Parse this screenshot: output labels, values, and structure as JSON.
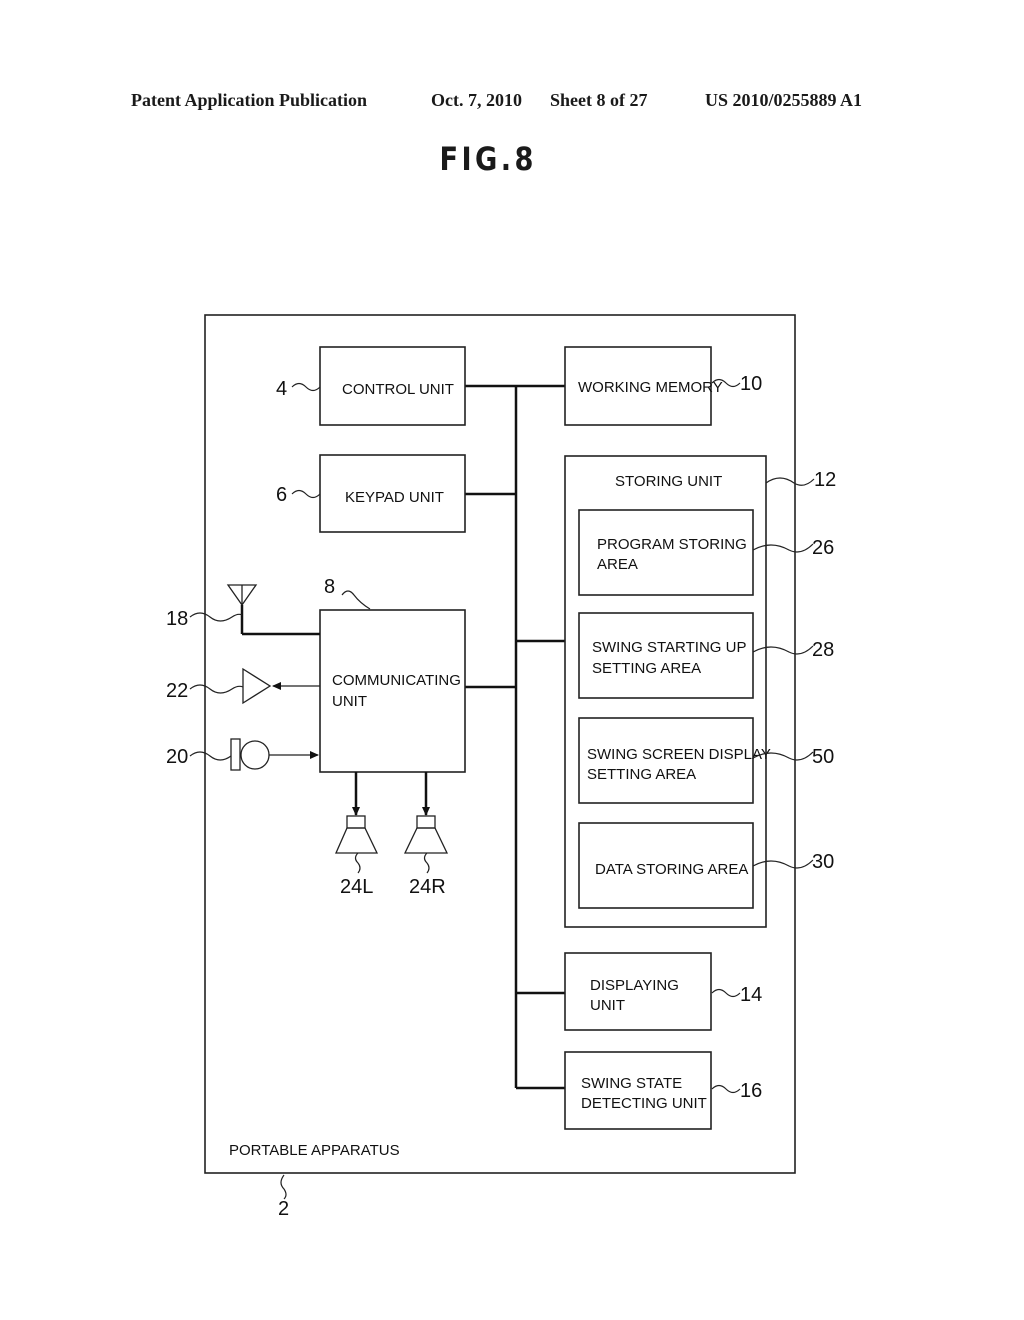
{
  "header": {
    "publication": "Patent Application Publication",
    "date": "Oct. 7, 2010",
    "sheet": "Sheet 8 of 27",
    "number": "US 2010/0255889 A1"
  },
  "figure": {
    "title": "FIG.8"
  },
  "diagram": {
    "outer": {
      "label": "PORTABLE APPARATUS",
      "ref": "2"
    },
    "control_unit": {
      "line1": "CONTROL UNIT",
      "ref": "4"
    },
    "keypad_unit": {
      "line1": "KEYPAD UNIT",
      "ref": "6"
    },
    "communicating_unit": {
      "line1": "COMMUNICATING",
      "line2": "UNIT",
      "ref": "8"
    },
    "working_memory": {
      "line1": "WORKING MEMORY",
      "ref": "10"
    },
    "storing_unit": {
      "line1": "STORING UNIT",
      "ref": "12"
    },
    "program_storing_area": {
      "line1": "PROGRAM STORING",
      "line2": "AREA",
      "ref": "26"
    },
    "swing_starting_up_area": {
      "line1": "SWING STARTING UP",
      "line2": "SETTING AREA",
      "ref": "28"
    },
    "swing_screen_display_area": {
      "line1": "SWING SCREEN DISPLAY",
      "line2": "SETTING AREA",
      "ref": "50"
    },
    "data_storing_area": {
      "line1": "DATA STORING AREA",
      "ref": "30"
    },
    "displaying_unit": {
      "line1": "DISPLAYING",
      "line2": "UNIT",
      "ref": "14"
    },
    "swing_state_detecting_unit": {
      "line1": "SWING STATE",
      "line2": "DETECTING UNIT",
      "ref": "16"
    },
    "antenna": {
      "ref": "18"
    },
    "microphone": {
      "ref": "20"
    },
    "receiver_amp": {
      "ref": "22"
    },
    "speaker_left": {
      "ref": "24L"
    },
    "speaker_right": {
      "ref": "24R"
    }
  }
}
